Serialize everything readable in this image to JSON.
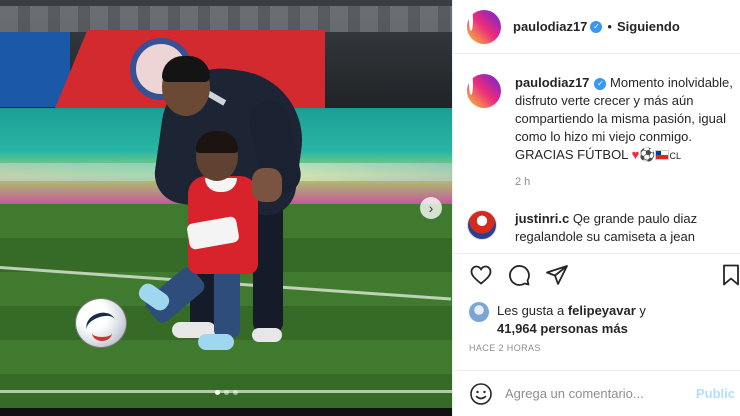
{
  "post": {
    "carousel": {
      "slide_count": 3,
      "active_slide": 1,
      "next_icon": "chevron-right-icon"
    }
  },
  "header": {
    "username": "paulodiaz17",
    "verified_icon": "verified-badge-icon",
    "separator": "•",
    "follow_status": "Siguiendo"
  },
  "caption": {
    "username": "paulodiaz17",
    "text": "Momento inolvidable, disfruto verte crecer y más aún compartiendo la misma pasión, igual como lo hizo mi viejo conmigo. GRACIAS FÚTBOL",
    "emojis_suffix": "⚽",
    "cl_text": "CL",
    "timestamp": "2 h"
  },
  "comment": {
    "username": "justinri.c",
    "text": "Qe grande paulo diaz regalandole su camiseta a jean"
  },
  "actions": {
    "like_icon": "heart-icon",
    "comment_icon": "comment-icon",
    "share_icon": "send-icon",
    "save_icon": "bookmark-icon"
  },
  "likes": {
    "prefix": "Les gusta a",
    "user": "felipeyavar",
    "connector": "y",
    "count_text": "41,964 personas más"
  },
  "posted_ago": "HACE 2 HORAS",
  "comment_box": {
    "emoji_icon": "emoji-smile-icon",
    "placeholder": "Agrega un comentario...",
    "publish_label": "Public"
  },
  "colors": {
    "accent_blue": "#3897f0",
    "publish_disabled": "#b2dffc",
    "muted_text": "#8e8e8e"
  }
}
